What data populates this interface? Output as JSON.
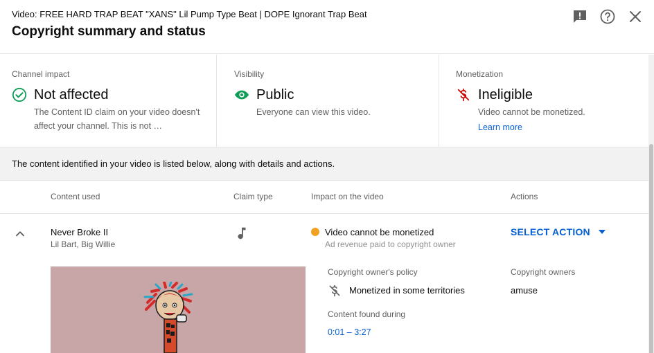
{
  "header": {
    "video_title": "Video: FREE HARD TRAP BEAT \"XANS\" Lil Pump Type Beat | DOPE Ignorant Trap Beat",
    "dialog_title": "Copyright summary and status",
    "icons": [
      "feedback-icon",
      "help-icon",
      "close-icon"
    ]
  },
  "impact": {
    "channel": {
      "label": "Channel impact",
      "title": "Not affected",
      "description": "The Content ID claim on your video doesn't affect your channel. This is not …",
      "icon": "check-circle-icon",
      "color": "#0f9d58"
    },
    "visibility": {
      "label": "Visibility",
      "title": "Public",
      "description": "Everyone can view this video.",
      "icon": "eye-icon",
      "color": "#0f9d58"
    },
    "monetization": {
      "label": "Monetization",
      "title": "Ineligible",
      "description": "Video cannot be monetized.",
      "link": "Learn more",
      "icon": "dollar-off-icon",
      "color": "#cc0000"
    }
  },
  "info_band": "The content identified in your video is listed below, along with details and actions.",
  "table": {
    "headers": {
      "content_used": "Content used",
      "claim_type": "Claim type",
      "impact": "Impact on the video",
      "actions": "Actions"
    },
    "row": {
      "title": "Never Broke II",
      "artists": "Lil Bart, Big Willie",
      "claim_type_icon": "music-note-icon",
      "impact_text": "Video cannot be monetized",
      "impact_sub": "Ad revenue paid to copyright owner",
      "impact_color": "#f2a223",
      "action_label": "SELECT ACTION",
      "policy_label": "Copyright owner's policy",
      "policy_value": "Monetized in some territories",
      "owners_label": "Copyright owners",
      "owners_value": "amuse",
      "found_label": "Content found during",
      "found_value": "0:01 – 3:27"
    }
  },
  "colors": {
    "link": "#065fd4",
    "green": "#0f9d58",
    "red": "#cc0000",
    "thumbnail_bg": "#c8a5a6"
  }
}
